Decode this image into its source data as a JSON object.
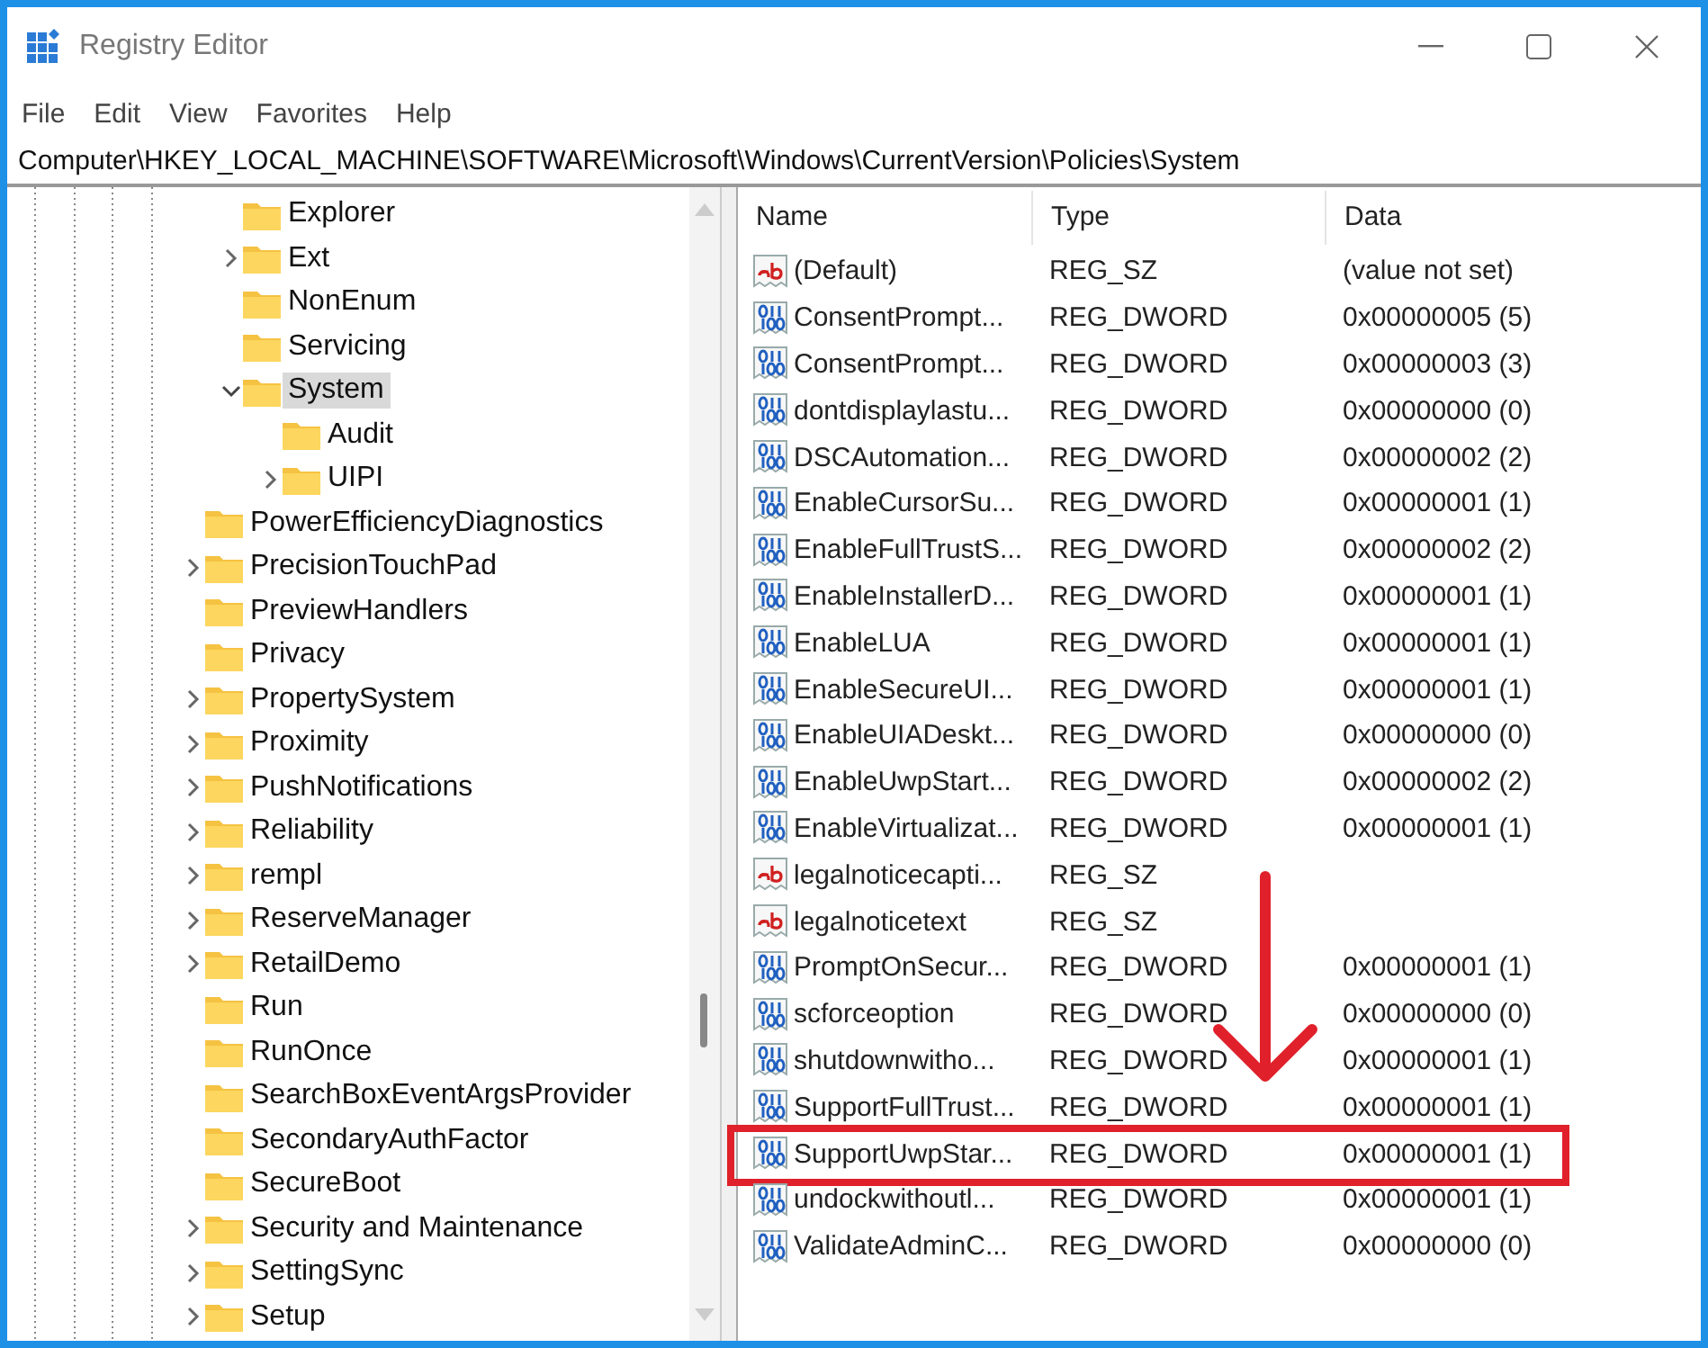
{
  "window": {
    "title": "Registry Editor"
  },
  "menu": [
    "File",
    "Edit",
    "View",
    "Favorites",
    "Help"
  ],
  "address": "Computer\\HKEY_LOCAL_MACHINE\\SOFTWARE\\Microsoft\\Windows\\CurrentVersion\\Policies\\System",
  "tree": {
    "nested_items": [
      {
        "label": "Explorer",
        "expandable": false,
        "selected": false
      },
      {
        "label": "Ext",
        "expandable": true,
        "expanded": false,
        "selected": false
      },
      {
        "label": "NonEnum",
        "expandable": false,
        "selected": false
      },
      {
        "label": "Servicing",
        "expandable": false,
        "selected": false
      },
      {
        "label": "System",
        "expandable": true,
        "expanded": true,
        "selected": true,
        "children": [
          {
            "label": "Audit",
            "expandable": false,
            "selected": false
          },
          {
            "label": "UIPI",
            "expandable": true,
            "expanded": false,
            "selected": false
          }
        ]
      }
    ],
    "items": [
      {
        "label": "PowerEfficiencyDiagnostics",
        "expandable": false,
        "selected": false
      },
      {
        "label": "PrecisionTouchPad",
        "expandable": true,
        "expanded": false,
        "selected": false
      },
      {
        "label": "PreviewHandlers",
        "expandable": false,
        "selected": false
      },
      {
        "label": "Privacy",
        "expandable": false,
        "selected": false
      },
      {
        "label": "PropertySystem",
        "expandable": true,
        "expanded": false,
        "selected": false
      },
      {
        "label": "Proximity",
        "expandable": true,
        "expanded": false,
        "selected": false
      },
      {
        "label": "PushNotifications",
        "expandable": true,
        "expanded": false,
        "selected": false
      },
      {
        "label": "Reliability",
        "expandable": true,
        "expanded": false,
        "selected": false
      },
      {
        "label": "rempl",
        "expandable": true,
        "expanded": false,
        "selected": false
      },
      {
        "label": "ReserveManager",
        "expandable": true,
        "expanded": false,
        "selected": false
      },
      {
        "label": "RetailDemo",
        "expandable": true,
        "expanded": false,
        "selected": false
      },
      {
        "label": "Run",
        "expandable": false,
        "selected": false
      },
      {
        "label": "RunOnce",
        "expandable": false,
        "selected": false
      },
      {
        "label": "SearchBoxEventArgsProvider",
        "expandable": false,
        "selected": false
      },
      {
        "label": "SecondaryAuthFactor",
        "expandable": false,
        "selected": false
      },
      {
        "label": "SecureBoot",
        "expandable": false,
        "selected": false
      },
      {
        "label": "Security and Maintenance",
        "expandable": true,
        "expanded": false,
        "selected": false
      },
      {
        "label": "SettingSync",
        "expandable": true,
        "expanded": false,
        "selected": false
      },
      {
        "label": "Setup",
        "expandable": true,
        "expanded": false,
        "selected": false
      }
    ]
  },
  "values": {
    "columns": [
      "Name",
      "Type",
      "Data"
    ],
    "rows": [
      {
        "kind": "string",
        "name": "(Default)",
        "type": "REG_SZ",
        "data": "(value not set)",
        "highlighted": false
      },
      {
        "kind": "dword",
        "name": "ConsentPrompt...",
        "type": "REG_DWORD",
        "data": "0x00000005 (5)",
        "highlighted": false
      },
      {
        "kind": "dword",
        "name": "ConsentPrompt...",
        "type": "REG_DWORD",
        "data": "0x00000003 (3)",
        "highlighted": false
      },
      {
        "kind": "dword",
        "name": "dontdisplaylastu...",
        "type": "REG_DWORD",
        "data": "0x00000000 (0)",
        "highlighted": false
      },
      {
        "kind": "dword",
        "name": "DSCAutomation...",
        "type": "REG_DWORD",
        "data": "0x00000002 (2)",
        "highlighted": false
      },
      {
        "kind": "dword",
        "name": "EnableCursorSu...",
        "type": "REG_DWORD",
        "data": "0x00000001 (1)",
        "highlighted": false
      },
      {
        "kind": "dword",
        "name": "EnableFullTrustS...",
        "type": "REG_DWORD",
        "data": "0x00000002 (2)",
        "highlighted": false
      },
      {
        "kind": "dword",
        "name": "EnableInstallerD...",
        "type": "REG_DWORD",
        "data": "0x00000001 (1)",
        "highlighted": false
      },
      {
        "kind": "dword",
        "name": "EnableLUA",
        "type": "REG_DWORD",
        "data": "0x00000001 (1)",
        "highlighted": false
      },
      {
        "kind": "dword",
        "name": "EnableSecureUI...",
        "type": "REG_DWORD",
        "data": "0x00000001 (1)",
        "highlighted": false
      },
      {
        "kind": "dword",
        "name": "EnableUIADeskt...",
        "type": "REG_DWORD",
        "data": "0x00000000 (0)",
        "highlighted": false
      },
      {
        "kind": "dword",
        "name": "EnableUwpStart...",
        "type": "REG_DWORD",
        "data": "0x00000002 (2)",
        "highlighted": false
      },
      {
        "kind": "dword",
        "name": "EnableVirtualizat...",
        "type": "REG_DWORD",
        "data": "0x00000001 (1)",
        "highlighted": false
      },
      {
        "kind": "string",
        "name": "legalnoticecapti...",
        "type": "REG_SZ",
        "highlighted": false
      },
      {
        "kind": "string",
        "name": "legalnoticetext",
        "type": "REG_SZ",
        "highlighted": false
      },
      {
        "kind": "dword",
        "name": "PromptOnSecur...",
        "type": "REG_DWORD",
        "data": "0x00000001 (1)",
        "highlighted": false
      },
      {
        "kind": "dword",
        "name": "scforceoption",
        "type": "REG_DWORD",
        "data": "0x00000000 (0)",
        "highlighted": false
      },
      {
        "kind": "dword",
        "name": "shutdownwitho...",
        "type": "REG_DWORD",
        "data": "0x00000001 (1)",
        "highlighted": false
      },
      {
        "kind": "dword",
        "name": "SupportFullTrust...",
        "type": "REG_DWORD",
        "data": "0x00000001 (1)",
        "highlighted": false
      },
      {
        "kind": "dword",
        "name": "SupportUwpStar...",
        "type": "REG_DWORD",
        "data": "0x00000001 (1)",
        "highlighted": true
      },
      {
        "kind": "dword",
        "name": "undockwithoutl...",
        "type": "REG_DWORD",
        "data": "0x00000001 (1)",
        "highlighted": false
      },
      {
        "kind": "dword",
        "name": "ValidateAdminC...",
        "type": "REG_DWORD",
        "data": "0x00000000 (0)",
        "highlighted": false
      }
    ]
  }
}
